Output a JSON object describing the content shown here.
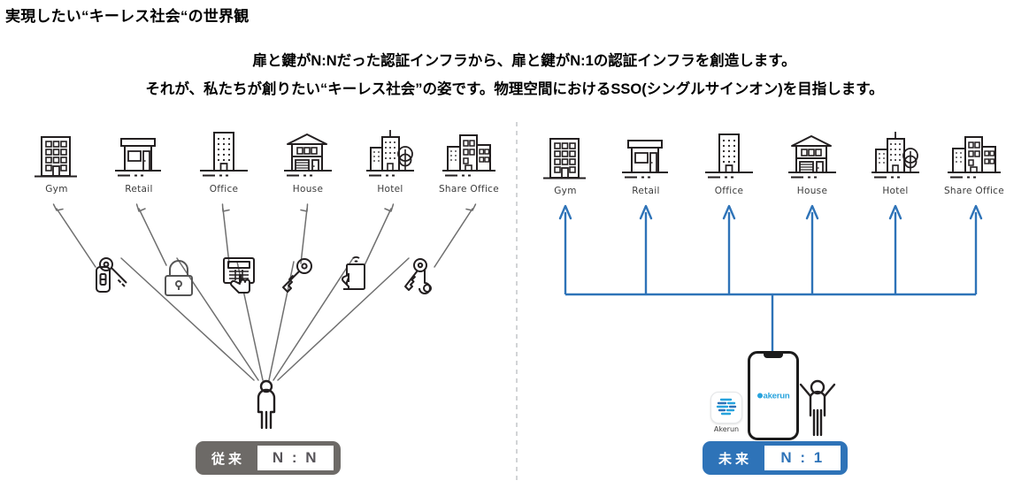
{
  "header": {
    "title": "実現したい“キーレス社会“の世界観",
    "subtitle_line1": "扉と鍵がN:Nだった認証インフラから、扉と鍵がN:1の認証インフラを創造します。",
    "subtitle_line2": "それが、私たちが創りたい“キーレス社会”の姿です。物理空間におけるSSO(シングルサインオン)を目指します。"
  },
  "colors": {
    "accent_blue": "#2e73b8",
    "past_gray": "#6d6a67",
    "line_gray": "#6f6f6f",
    "ink": "#231f20",
    "akerun_cyan": "#27a3dd",
    "divider": "#d2d4d6"
  },
  "left_panel": {
    "name": "conventional",
    "buildings": [
      {
        "label": "Gym",
        "icon": "gym-building-icon"
      },
      {
        "label": "Retail",
        "icon": "retail-store-icon"
      },
      {
        "label": "Office",
        "icon": "office-tower-icon"
      },
      {
        "label": "House",
        "icon": "house-icon"
      },
      {
        "label": "Hotel",
        "icon": "hotel-icon"
      },
      {
        "label": "Share Office",
        "icon": "share-office-icon"
      }
    ],
    "auth_methods": [
      {
        "icon": "keyfob-with-key-icon"
      },
      {
        "icon": "padlock-icon"
      },
      {
        "icon": "keypad-with-hand-icon"
      },
      {
        "icon": "single-key-icon"
      },
      {
        "icon": "smartphone-tap-icon"
      },
      {
        "icon": "key-ring-icon"
      }
    ],
    "person_icon": "standing-person-icon",
    "badge": {
      "label": "従来",
      "value": "N : N"
    }
  },
  "right_panel": {
    "name": "future",
    "buildings": [
      {
        "label": "Gym",
        "icon": "gym-building-icon"
      },
      {
        "label": "Retail",
        "icon": "retail-store-icon"
      },
      {
        "label": "Office",
        "icon": "office-tower-icon"
      },
      {
        "label": "House",
        "icon": "house-icon"
      },
      {
        "label": "Hotel",
        "icon": "hotel-icon"
      },
      {
        "label": "Share Office",
        "icon": "share-office-icon"
      }
    ],
    "app": {
      "name": "Akerun",
      "icon": "akerun-app-icon"
    },
    "phone": {
      "logo_text": "akerun",
      "icon": "smartphone-icon"
    },
    "person_icon": "cheering-person-icon",
    "badge": {
      "label": "未来",
      "value": "N : 1"
    }
  }
}
